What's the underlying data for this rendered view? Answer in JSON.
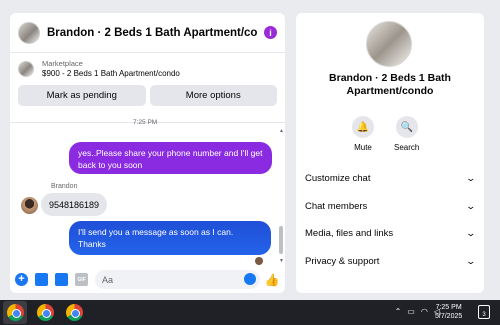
{
  "chat": {
    "title": "Brandon · 2 Beds 1 Bath Apartment/co...",
    "marketplace_label": "Marketplace",
    "listing": "$900 - 2 Beds 1 Bath Apartment/condo",
    "mark_pending_label": "Mark as pending",
    "more_options_label": "More options",
    "time_partial": "7:25 PM",
    "messages": [
      {
        "from": "me",
        "text": "yes..Please share your phone number and I'll get back to you soon"
      },
      {
        "from": "Brandon",
        "sender_label": "Brandon",
        "text": "9548186189"
      },
      {
        "from": "me",
        "text": "I'll send you a message as soon as I can. Thanks"
      }
    ],
    "composer_placeholder": "Aa",
    "gif_label": "GIF"
  },
  "info_panel": {
    "title": "Brandon · 2 Beds 1 Bath Apartment/condo",
    "mute_label": "Mute",
    "search_label": "Search",
    "menu": [
      "Customize chat",
      "Chat members",
      "Media, files and links",
      "Privacy & support"
    ]
  },
  "taskbar": {
    "time": "7:25 PM",
    "date": "5/7/2025",
    "notification_count": "3"
  },
  "icons": {
    "info": "info-icon",
    "mute": "bell-icon",
    "search": "search-icon",
    "chevron": "chevron-down-icon",
    "like": "thumbs-up-icon"
  },
  "colors": {
    "accent": "#1877f2",
    "purple_bubble": "#8a2be2",
    "blue_bubble": "#2463eb"
  }
}
